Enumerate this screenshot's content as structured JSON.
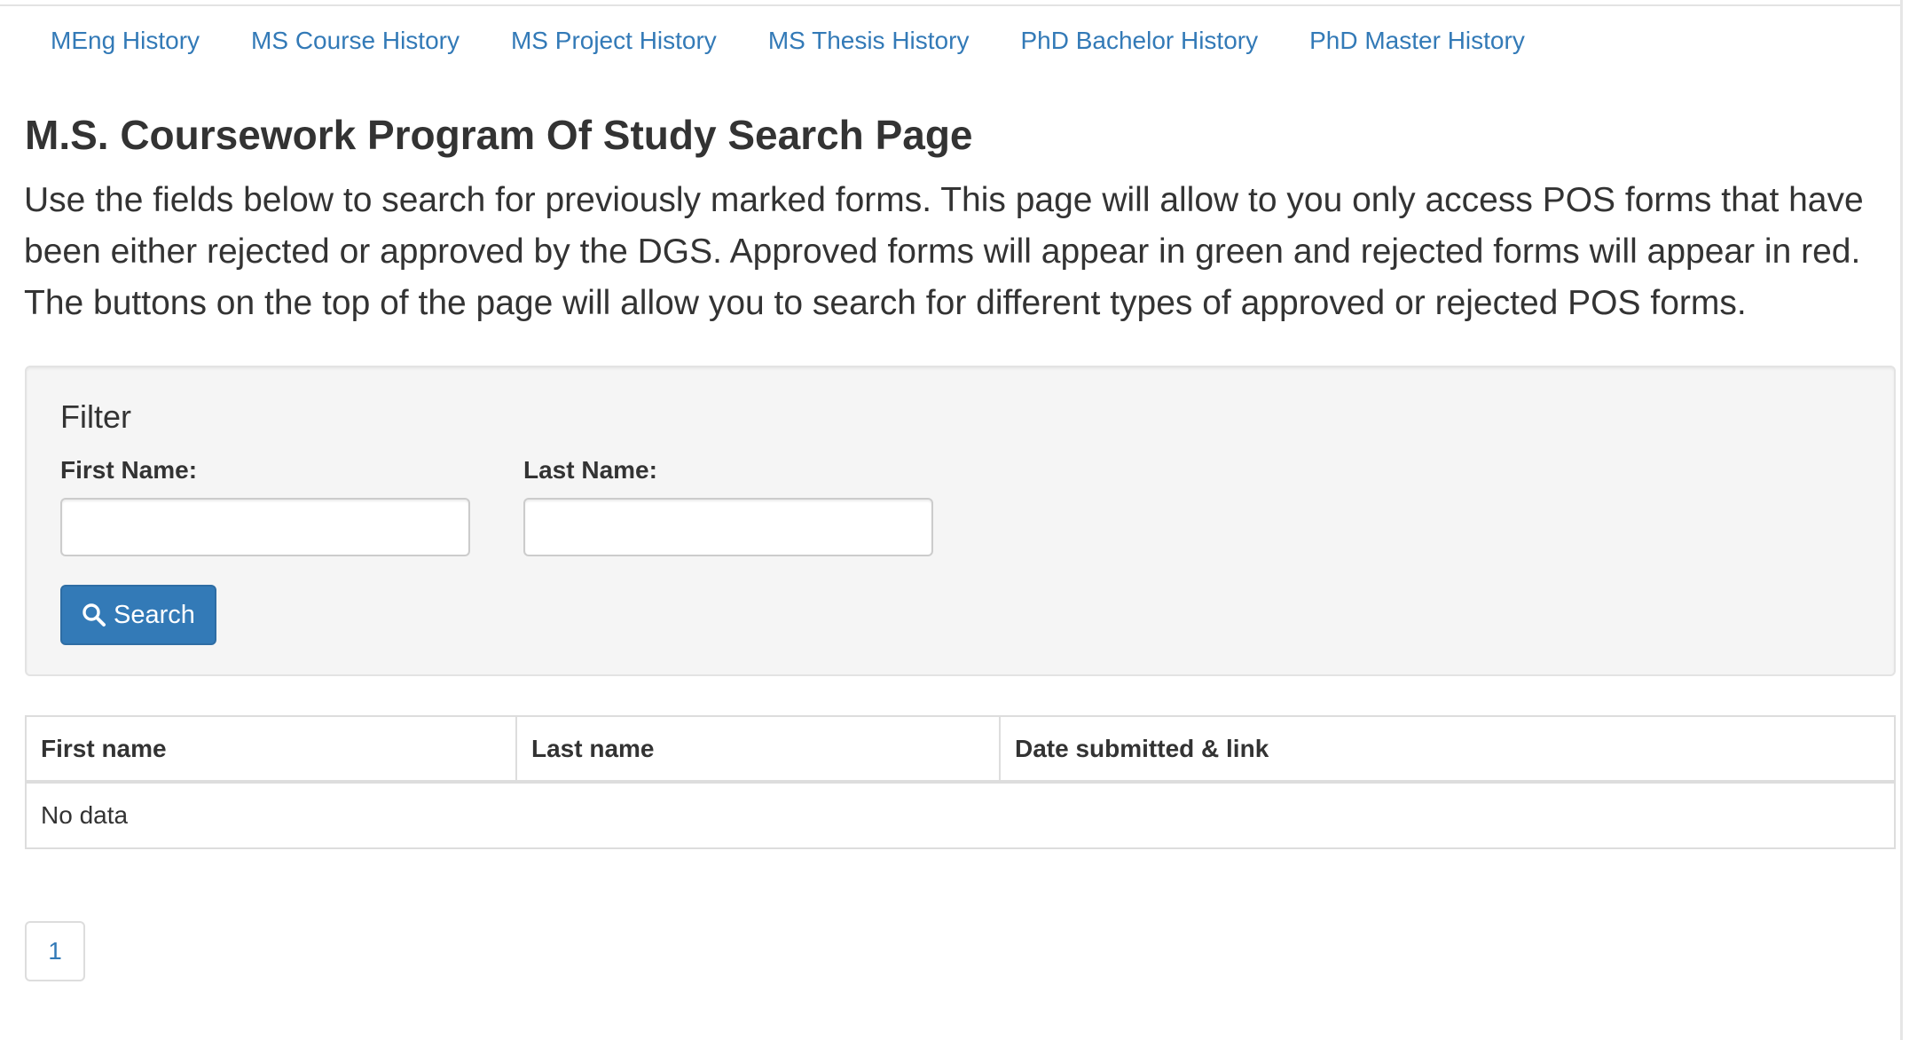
{
  "nav": {
    "items": [
      {
        "label": "MEng History"
      },
      {
        "label": "MS Course History"
      },
      {
        "label": "MS Project History"
      },
      {
        "label": "MS Thesis History"
      },
      {
        "label": "PhD Bachelor History"
      },
      {
        "label": "PhD Master History"
      }
    ]
  },
  "page": {
    "title": "M.S. Coursework Program Of Study Search Page",
    "description": "Use the fields below to search for previously marked forms. This page will allow to you only access POS forms that have been either rejected or approved by the DGS. Approved forms will appear in green and rejected forms will appear in red. The buttons on the top of the page will allow you to search for different types of approved or rejected POS forms."
  },
  "filter": {
    "heading": "Filter",
    "first_name_label": "First Name:",
    "first_name_value": "",
    "last_name_label": "Last Name:",
    "last_name_value": "",
    "search_label": "Search",
    "search_icon": "search-icon"
  },
  "table": {
    "columns": [
      "First name",
      "Last name",
      "Date submitted & link"
    ],
    "empty_message": "No data"
  },
  "pagination": {
    "current_page": "1"
  },
  "colors": {
    "link": "#337ab7",
    "primary_button": "#337ab7",
    "well_background": "#f5f5f5",
    "text": "#333333"
  }
}
